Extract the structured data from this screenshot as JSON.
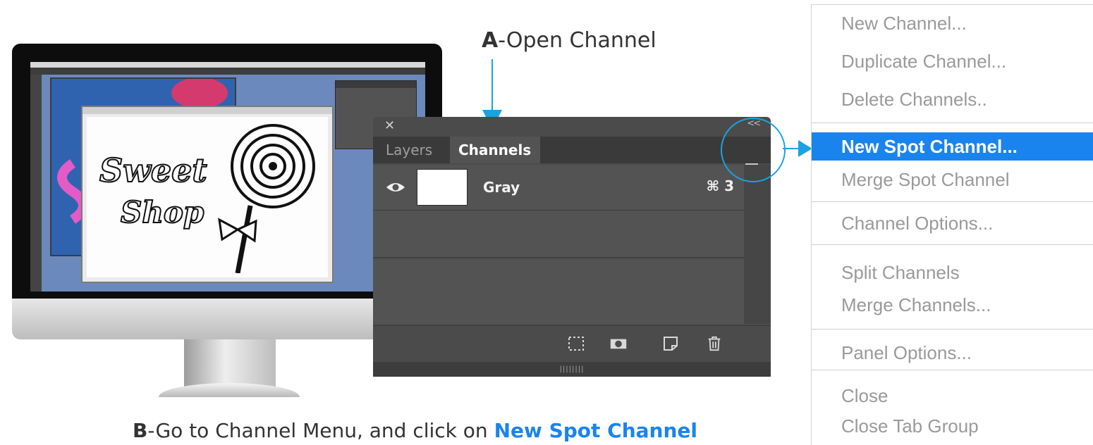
{
  "annotations": {
    "a_letter": "A",
    "a_text": "-Open Channel",
    "b_letter": "B",
    "b_text": "-Go to Channel Menu, and click on ",
    "b_link": "New Spot Channel"
  },
  "panel": {
    "close_icon": "close-icon",
    "collapse_label": "<<",
    "tabs": [
      {
        "label": "Layers",
        "active": false
      },
      {
        "label": "Channels",
        "active": true
      }
    ],
    "channel": {
      "name": "Gray",
      "shortcut": "⌘ 3",
      "visible": true
    },
    "footer_icons": [
      "load-selection-icon",
      "save-selection-icon",
      "new-channel-icon",
      "trash-icon"
    ],
    "grip": "||||||||"
  },
  "menu": {
    "items": [
      {
        "label": "New Channel...",
        "active": false
      },
      {
        "label": "Duplicate Channel...",
        "active": false
      },
      {
        "label": "Delete Channels..",
        "active": false
      },
      {
        "label": "New Spot Channel...",
        "active": true
      },
      {
        "label": "Merge Spot Channel",
        "active": false
      },
      {
        "label": "Channel Options...",
        "active": false
      },
      {
        "label": "Split Channels",
        "active": false
      },
      {
        "label": "Merge Channels...",
        "active": false
      },
      {
        "label": "Panel Options...",
        "active": false
      },
      {
        "label": "Close",
        "active": false
      },
      {
        "label": "Close Tab Group",
        "active": false
      }
    ]
  },
  "colors": {
    "accent": "#1aa3e0",
    "highlight": "#1a84ee",
    "panel_bg": "#4b4b4b"
  }
}
